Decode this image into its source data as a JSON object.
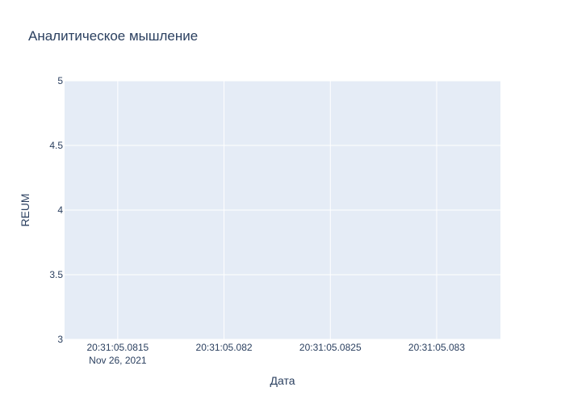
{
  "chart_data": {
    "type": "line",
    "title": "Аналитическое мышление",
    "xlabel": "Дата",
    "ylabel": "REUM",
    "xlim": [
      "20:31:05.08125",
      "20:31:05.0833"
    ],
    "ylim": [
      3,
      5
    ],
    "x_ticks": [
      {
        "value": "20:31:05.0815",
        "label": "20:31:05.0815",
        "sublabel": "Nov 26, 2021"
      },
      {
        "value": "20:31:05.082",
        "label": "20:31:05.082",
        "sublabel": ""
      },
      {
        "value": "20:31:05.0825",
        "label": "20:31:05.0825",
        "sublabel": ""
      },
      {
        "value": "20:31:05.083",
        "label": "20:31:05.083",
        "sublabel": ""
      }
    ],
    "y_ticks": [
      {
        "value": 3,
        "label": "3"
      },
      {
        "value": 3.5,
        "label": "3.5"
      },
      {
        "value": 4,
        "label": "4"
      },
      {
        "value": 4.5,
        "label": "4.5"
      },
      {
        "value": 5,
        "label": "5"
      }
    ],
    "grid": true,
    "series": [],
    "colors": {
      "plot_background": "#e5ecf6",
      "grid": "#ffffff",
      "text": "#2a3f5f"
    }
  }
}
